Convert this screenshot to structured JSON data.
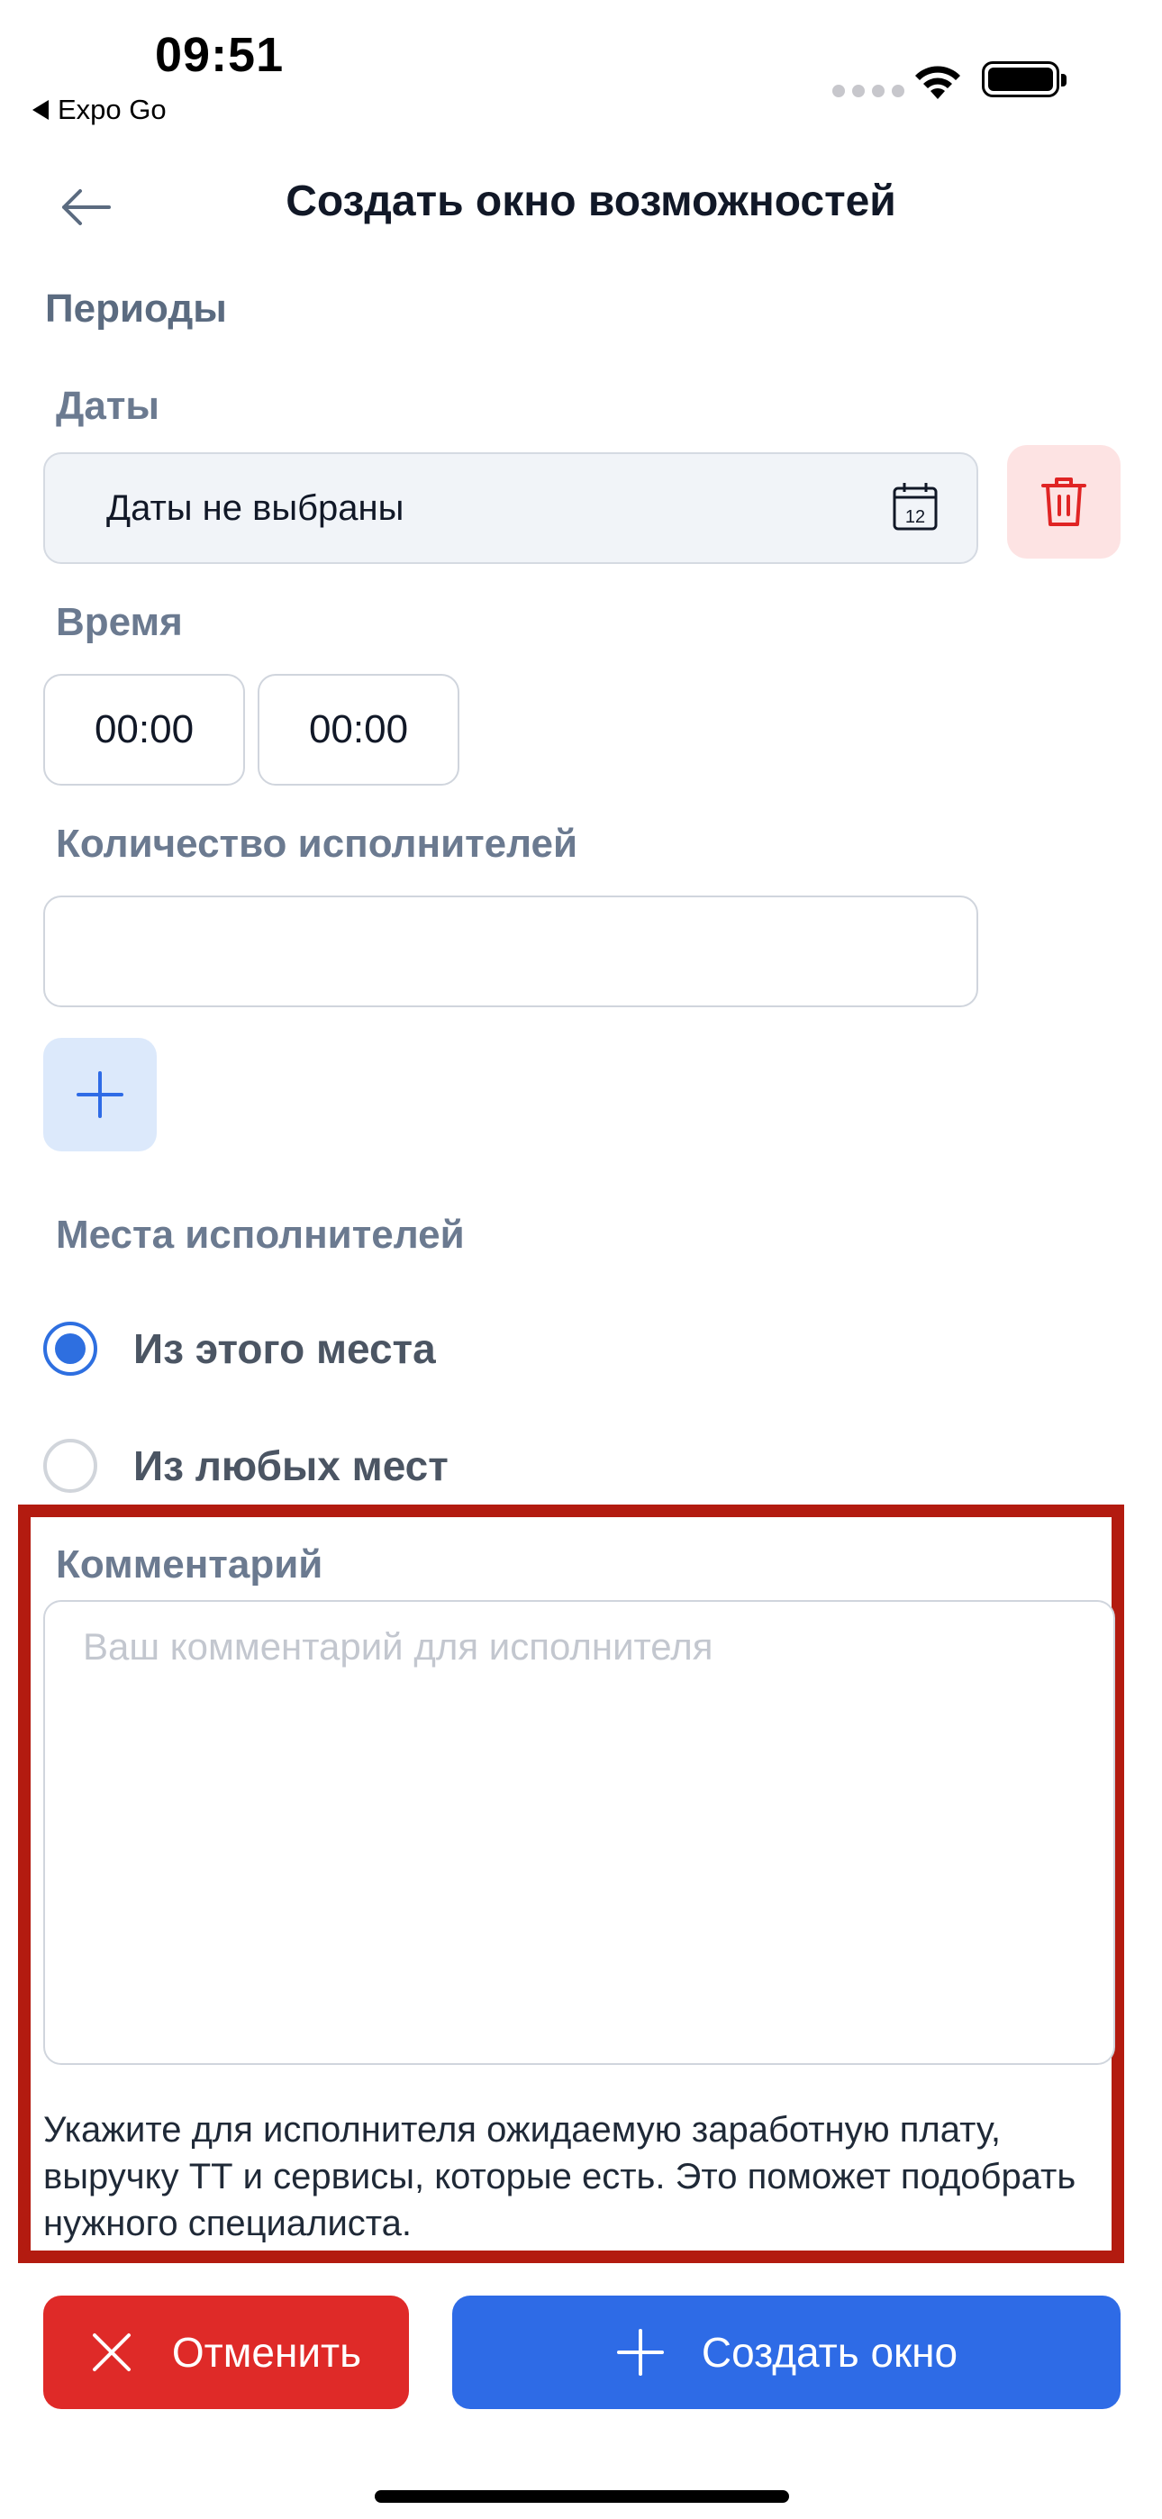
{
  "status_bar": {
    "time": "09:51",
    "back_app": "Expo Go"
  },
  "header": {
    "title": "Создать окно возможностей",
    "back_icon": "arrow-left-icon"
  },
  "periods": {
    "section_label": "Периоды",
    "dates_label": "Даты",
    "dates_value": "Даты не выбраны",
    "calendar_day": "12",
    "time_label": "Время",
    "time_from": "00:00",
    "time_to": "00:00",
    "performers_count_label": "Количество исполнителей",
    "performers_count_value": ""
  },
  "places": {
    "label": "Места исполнителей",
    "options": [
      {
        "label": "Из этого места",
        "checked": true
      },
      {
        "label": "Из любых мест",
        "checked": false
      }
    ]
  },
  "comment": {
    "label": "Комментарий",
    "placeholder": "Ваш комментарий для исполнителя",
    "hint": "Укажите для исполнителя ожидаемую заработную плату, выручку ТТ и сервисы, которые есть. Это поможет подобрать нужного специалиста."
  },
  "actions": {
    "cancel_label": "Отменить",
    "create_label": "Создать окно"
  },
  "colors": {
    "primary": "#2e6be6",
    "danger": "#df2a28",
    "highlight_border": "#b31b10"
  }
}
